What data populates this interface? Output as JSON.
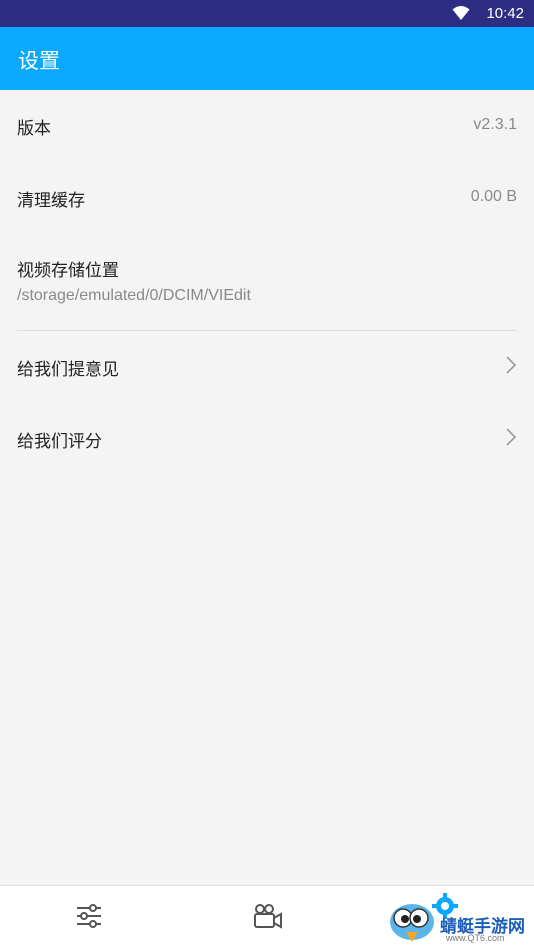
{
  "status_bar": {
    "time": "10:42"
  },
  "app_bar": {
    "title": "设置"
  },
  "settings": {
    "version": {
      "label": "版本",
      "value": "v2.3.1"
    },
    "cache": {
      "label": "清理缓存",
      "value": "0.00 B"
    },
    "storage": {
      "label": "视频存储位置",
      "path": "/storage/emulated/0/DCIM/VIEdit"
    },
    "feedback": {
      "label": "给我们提意见"
    },
    "rate": {
      "label": "给我们评分"
    }
  },
  "bottom_nav": {
    "items": [
      {
        "icon": "sliders-icon"
      },
      {
        "icon": "video-camera-icon"
      },
      {
        "icon": "gear-icon",
        "active": true
      }
    ]
  },
  "watermark": {
    "brand": "蜻蜓手游网",
    "url": "www.QT6.com"
  },
  "colors": {
    "status_bar": "#2d2e83",
    "app_bar": "#0aa8ff",
    "background": "#f4f4f4",
    "accent": "#0aa8ff"
  }
}
